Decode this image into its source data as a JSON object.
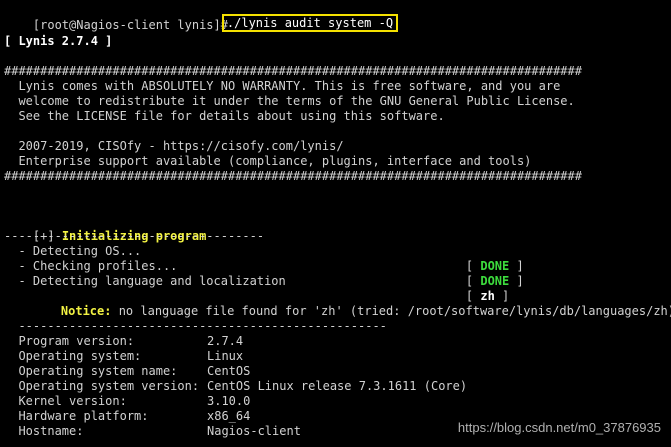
{
  "prompt": {
    "text": "[root@Nagios-client lynis]# ",
    "command": "./lynis audit system -Q"
  },
  "banner": {
    "version": "[ Lynis 2.7.4 ]",
    "hashes": "################################################################################",
    "warranty_lines": [
      "  Lynis comes with ABSOLUTELY NO WARRANTY. This is free software, and you are",
      "  welcome to redistribute it under the terms of the GNU General Public License.",
      "  See the LICENSE file for details about using this software."
    ],
    "copyright": "  2007-2019, CISOfy - https://cisofy.com/lynis/",
    "support": "  Enterprise support available (compliance, plugins, interface and tools)"
  },
  "section": {
    "marker": "[+] ",
    "title": "Initializing program",
    "underline": "------------------------------------"
  },
  "checks": [
    {
      "label": "  - Detecting OS...",
      "open": "[ ",
      "status": "DONE",
      "close": " ]"
    },
    {
      "label": "  - Checking profiles...",
      "open": "[ ",
      "status": "DONE",
      "close": " ]"
    },
    {
      "label": "  - Detecting language and localization",
      "open": "[ ",
      "status": "zh",
      "close": " ]"
    }
  ],
  "notice": {
    "label": "Notice:",
    "text": " no language file found for 'zh' (tried: /root/software/lynis/db/languages/zh)"
  },
  "separator": "  ---------------------------------------------------",
  "sysinfo": [
    {
      "key": "  Program version:",
      "value": "2.7.4"
    },
    {
      "key": "  Operating system:",
      "value": "Linux"
    },
    {
      "key": "  Operating system name:",
      "value": "CentOS"
    },
    {
      "key": "  Operating system version:",
      "value": "CentOS Linux release 7.3.1611 (Core)"
    },
    {
      "key": "  Kernel version:",
      "value": "3.10.0"
    },
    {
      "key": "  Hardware platform:",
      "value": "x86_64"
    },
    {
      "key": "  Hostname:",
      "value": "Nagios-client"
    }
  ],
  "watermark": "https://blog.csdn.net/m0_37876935",
  "colors": {
    "background": "#000000",
    "text": "#d2d2d2",
    "highlight_box": "#f5e100",
    "done": "#3ddc3d",
    "section_title": "#f2f243"
  }
}
